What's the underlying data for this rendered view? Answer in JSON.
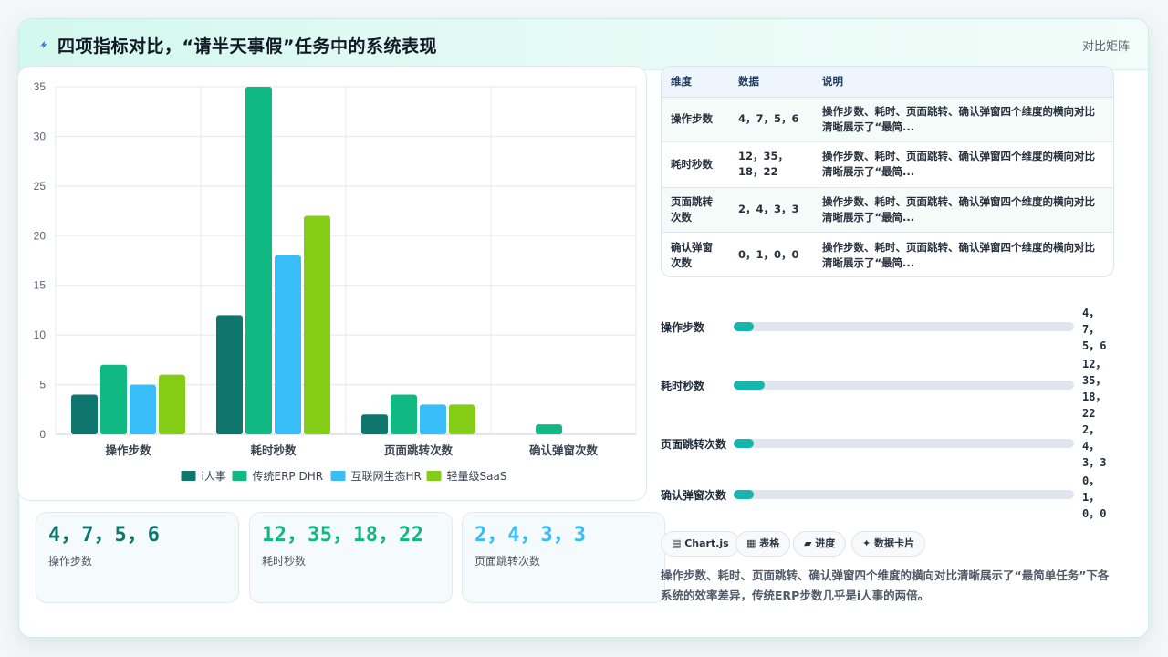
{
  "header": {
    "title": "四项指标对比，“请半天事假”任务中的系统表现",
    "right_label": "对比矩阵"
  },
  "colors": {
    "accent": "#16b5ae",
    "series": [
      "#0f766e",
      "#10b981",
      "#38bdf8",
      "#84cc16"
    ]
  },
  "chart_data": {
    "type": "bar",
    "categories": [
      "操作步数",
      "耗时秒数",
      "页面跳转次数",
      "确认弹窗次数"
    ],
    "series": [
      {
        "name": "i人事",
        "values": [
          4,
          12,
          2,
          0
        ],
        "color": "#0f766e"
      },
      {
        "name": "传统ERP DHR",
        "values": [
          7,
          35,
          4,
          1
        ],
        "color": "#10b981"
      },
      {
        "name": "互联网生态HR",
        "values": [
          5,
          18,
          3,
          0
        ],
        "color": "#38bdf8"
      },
      {
        "name": "轻量级SaaS",
        "values": [
          6,
          22,
          3,
          0
        ],
        "color": "#84cc16"
      }
    ],
    "ylim": [
      0,
      35
    ],
    "yticks": [
      0,
      5,
      10,
      15,
      20,
      25,
      30,
      35
    ],
    "grid": true,
    "legend_position": "bottom"
  },
  "stats": [
    {
      "value": "4，7，5，6",
      "label": "操作步数",
      "color": "#0f766e"
    },
    {
      "value": "12，35，18，22",
      "label": "耗时秒数",
      "color": "#10b981"
    },
    {
      "value": "2，4，3，3",
      "label": "页面跳转次数",
      "color": "#38bdf8"
    }
  ],
  "table": {
    "headers": [
      "维度",
      "数据",
      "说明"
    ],
    "rows": [
      {
        "dim": "操作步数",
        "data": "4，7，5，6",
        "note": "操作步数、耗时、页面跳转、确认弹窗四个维度的横向对比清晰展示了“最简..."
      },
      {
        "dim": "耗时秒数",
        "data": "12，35，18，22",
        "note": "操作步数、耗时、页面跳转、确认弹窗四个维度的横向对比清晰展示了“最简..."
      },
      {
        "dim": "页面跳转次数",
        "data": "2，4，3，3",
        "note": "操作步数、耗时、页面跳转、确认弹窗四个维度的横向对比清晰展示了“最简..."
      },
      {
        "dim": "确认弹窗次数",
        "data": "0，1，0，0",
        "note": "操作步数、耗时、页面跳转、确认弹窗四个维度的横向对比清晰展示了“最简..."
      }
    ]
  },
  "progress": [
    {
      "label": "操作步数",
      "value": "4，7，5，6",
      "fraction": 0.06
    },
    {
      "label": "耗时秒数",
      "value": "12，35，18，22",
      "fraction": 0.09
    },
    {
      "label": "页面跳转次数",
      "value": "2，4，3，3",
      "fraction": 0.06
    },
    {
      "label": "确认弹窗次数",
      "value": "0，1，0，0",
      "fraction": 0.06
    }
  ],
  "chips": [
    "▤ Chart.js",
    "▦ 表格",
    "▰ 进度",
    "✦ 数据卡片"
  ],
  "summary": "操作步数、耗时、页面跳转、确认弹窗四个维度的横向对比清晰展示了“最简单任务”下各系统的效率差异，传统ERP步数几乎是i人事的两倍。"
}
